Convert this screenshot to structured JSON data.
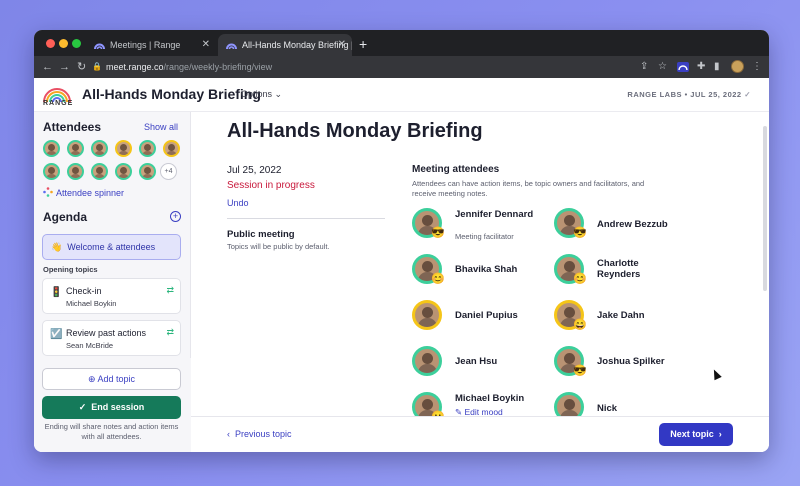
{
  "browser": {
    "tabs": [
      {
        "title": "Meetings | Range",
        "active": false
      },
      {
        "title": "All-Hands Monday Briefing | Ra",
        "active": true
      }
    ],
    "url_host": "meet.range.co",
    "url_path": "/range/weekly-briefing/view"
  },
  "header": {
    "logo_text": "RANGE",
    "title": "All-Hands Monday Briefing",
    "options_label": "Options",
    "org_label": "RANGE LABS • JUL 25, 2022"
  },
  "sidebar": {
    "attendees_heading": "Attendees",
    "show_all": "Show all",
    "more_count": "+4",
    "spinner_label": "Attendee spinner",
    "agenda_heading": "Agenda",
    "welcome_item": "Welcome & attendees",
    "welcome_emoji": "👋",
    "section_label": "Opening topics",
    "topics": [
      {
        "emoji": "🚦",
        "title": "Check-in",
        "owner": "Michael Boykin"
      },
      {
        "emoji": "☑️",
        "title": "Review past actions",
        "owner": "Sean McBride"
      }
    ],
    "add_topic": "Add topic",
    "end_session": "End session",
    "end_note": "Ending will share notes and action items with all attendees."
  },
  "main": {
    "title": "All-Hands Monday Briefing",
    "date": "Jul 25, 2022",
    "status": "Session in progress",
    "undo": "Undo",
    "public_heading": "Public meeting",
    "public_sub": "Topics will be public by default.",
    "attendees_heading": "Meeting attendees",
    "attendees_sub": "Attendees can have action items, be topic owners and facilitators, and receive meeting notes.",
    "attendees": [
      {
        "name": "Jennifer Dennard",
        "sub": "Meeting facilitator",
        "mood": "😎",
        "ring": "#3ccf9b"
      },
      {
        "name": "Andrew Bezzub",
        "mood": "😎",
        "ring": "#3ccf9b"
      },
      {
        "name": "Bhavika Shah",
        "mood": "😊",
        "ring": "#3ccf9b"
      },
      {
        "name": "Charlotte Reynders",
        "mood": "😊",
        "ring": "#3ccf9b"
      },
      {
        "name": "Daniel Pupius",
        "mood": "",
        "ring": "#f5c518"
      },
      {
        "name": "Jake Dahn",
        "mood": "😄",
        "ring": "#f5c518"
      },
      {
        "name": "Jean Hsu",
        "mood": "",
        "ring": "#3ccf9b"
      },
      {
        "name": "Joshua Spilker",
        "mood": "😎",
        "ring": "#3ccf9b"
      },
      {
        "name": "Michael Boykin",
        "edit": "Edit mood",
        "mood": "😐",
        "ring": "#3ccf9b"
      },
      {
        "name": "Nick",
        "mood": "",
        "ring": "#3ccf9b"
      }
    ],
    "prev_topic": "Previous topic",
    "next_topic": "Next topic"
  },
  "colors": {
    "accent": "#3238c4",
    "end_session": "#157a5a",
    "status_red": "#c8183b",
    "ring_green": "#3ccf9b",
    "ring_yellow": "#f5c518"
  }
}
